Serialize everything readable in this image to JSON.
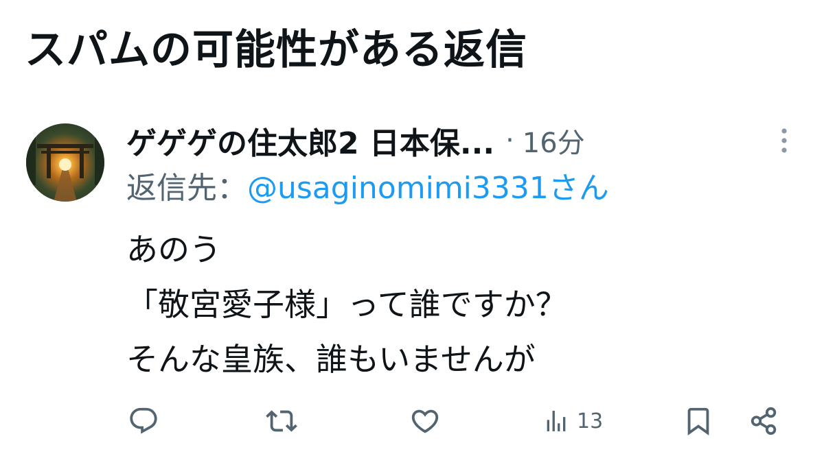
{
  "section": {
    "title": "スパムの可能性がある返信"
  },
  "tweet": {
    "display_name": "ゲゲゲの住太郎2 日本保...",
    "separator": "·",
    "time": "16分",
    "reply_prefix": "返信先：",
    "reply_handle": "@usaginomimi3331さん",
    "body_lines": [
      "あのう",
      "「敬宮愛子様」って誰ですか？",
      "そんな皇族、誰もいませんが"
    ]
  },
  "actions": {
    "reply_icon": "comment-icon",
    "retweet_icon": "retweet-icon",
    "like_icon": "heart-icon",
    "views_icon": "bar-chart-icon",
    "views_count": "13",
    "bookmark_icon": "bookmark-icon",
    "share_icon": "share-icon"
  },
  "colors": {
    "text_primary": "#0f1419",
    "text_secondary": "#536471",
    "accent_link": "#1d9bf0"
  }
}
